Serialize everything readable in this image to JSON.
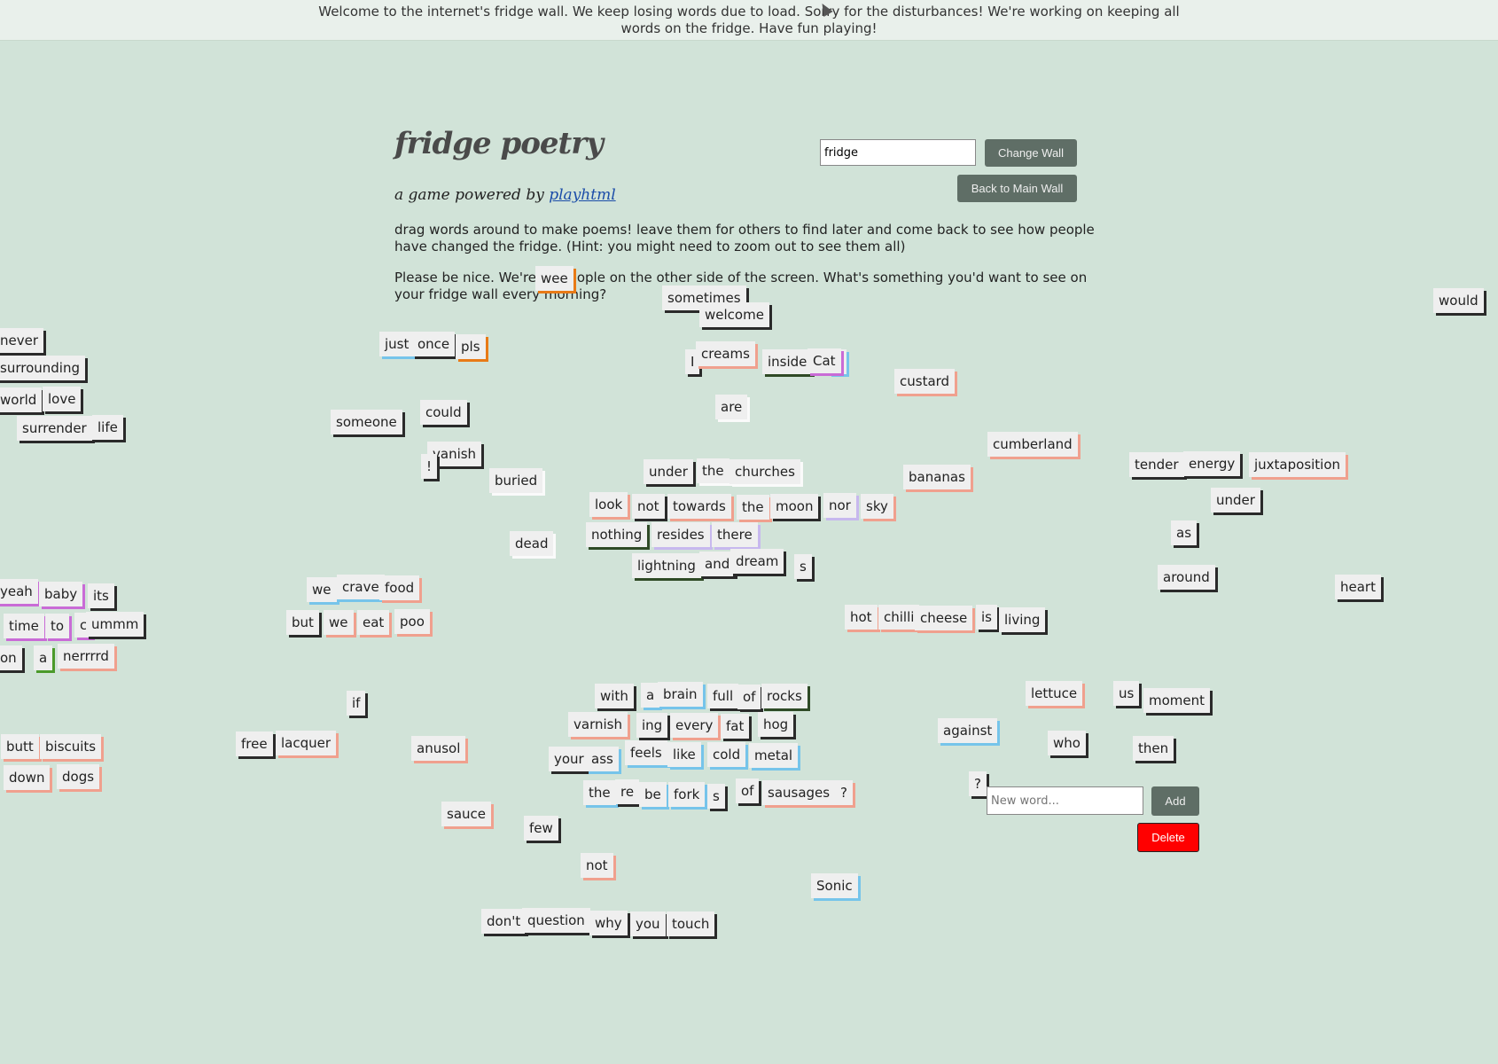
{
  "banner": {
    "text": "Welcome to the internet's fridge wall. We keep losing words due to load. Sorry for the disturbances! We're working on keeping all words on the fridge. Have fun playing!"
  },
  "header": {
    "title": "fridge poetry",
    "powered_prefix": "a game powered by ",
    "powered_link": "playhtml",
    "intro": "drag words around to make poems! leave them for others to find later and come back to see how people have changed the fridge. (Hint: you might need to zoom out to see them all)",
    "note": "Please be nice. We're all people on the other side of the screen. What's something you'd want to see on your fridge wall every morning?"
  },
  "controls": {
    "wall_value": "fridge",
    "change_wall_label": "Change Wall",
    "back_main_label": "Back to Main Wall",
    "new_word_placeholder": "New word...",
    "add_label": "Add",
    "delete_label": "Delete"
  },
  "words": [
    "wee",
    "sometimes",
    "welcome",
    "would",
    "never",
    "surrounding",
    "world",
    "love",
    "surrender",
    "life",
    "just",
    "once",
    "pls",
    "I",
    "creams",
    "s",
    "inside",
    "Cat",
    "custard",
    "someone",
    "could",
    "are",
    "vanish",
    "!",
    "buried",
    "cumberland",
    "under",
    "the",
    "churches",
    "bananas",
    "tender",
    "energy",
    "juxtaposition",
    "look",
    "not",
    "towards",
    "the",
    "moon",
    "nor",
    "sky",
    "under",
    "nothing",
    "resides",
    "there",
    "as",
    "dead",
    "lightning",
    "and",
    "dream",
    "s",
    "around",
    "heart",
    "yeah",
    "baby",
    "its",
    "we",
    "crave",
    "food",
    "time",
    "to",
    "c",
    "ummm",
    "but",
    "we",
    "eat",
    "poo",
    "hot",
    "chilli",
    "cheese",
    "is",
    "living",
    "on",
    "a",
    "nerrrrd",
    "with",
    "a",
    "brain",
    "full",
    "of",
    "rocks",
    "lettuce",
    "us",
    "moment",
    "if",
    "varnish",
    "ing",
    "every",
    "fat",
    "hog",
    "against",
    "butt",
    "biscuits",
    "free",
    "lacquer",
    "anusol",
    "your",
    "ass",
    "feels",
    "like",
    "cold",
    "metal",
    "who",
    "then",
    "down",
    "dogs",
    "the",
    "re",
    "be",
    "fork",
    "s",
    "of",
    "sausages",
    "?",
    "?",
    "sauce",
    "few",
    "not",
    "Sonic",
    "don't",
    "question",
    "why",
    "you",
    "touch"
  ]
}
